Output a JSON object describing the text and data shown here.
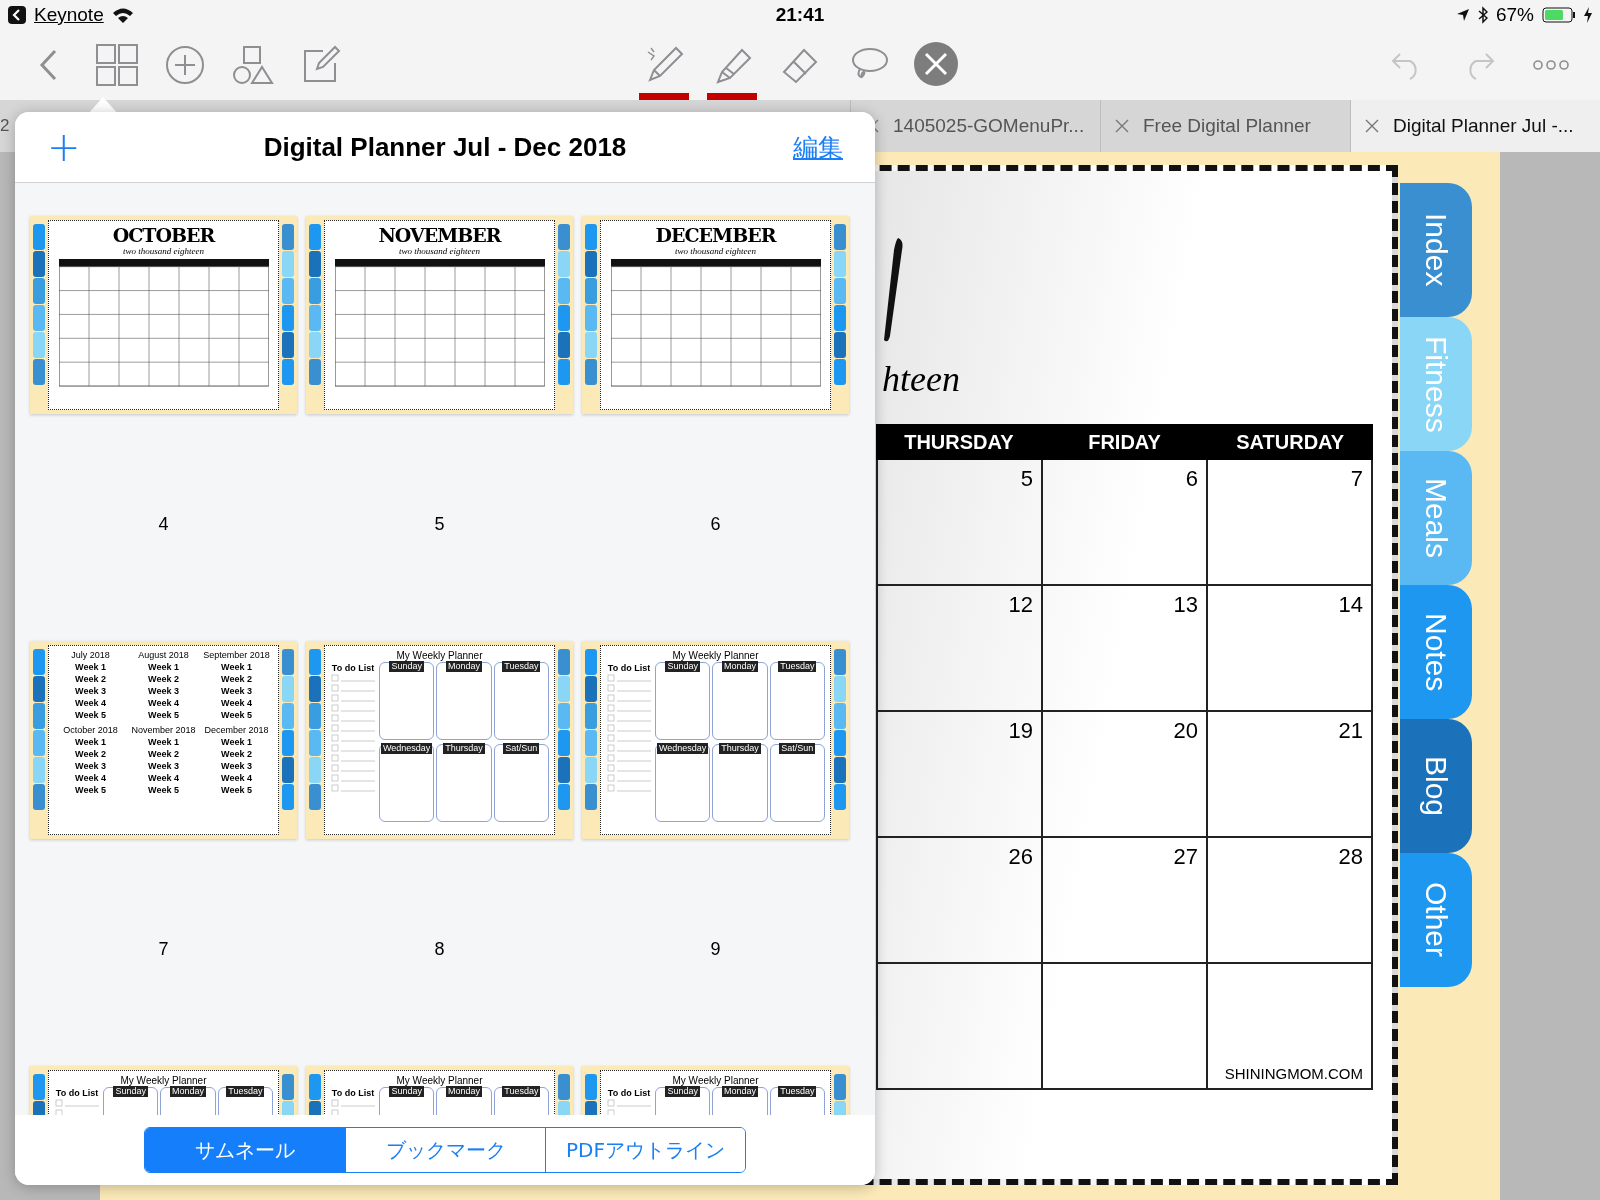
{
  "status_bar": {
    "back_app": "Keynote",
    "time": "21:41",
    "battery": "67%"
  },
  "drawing_tools": [
    {
      "kind": "pen",
      "color": "#c40000"
    },
    {
      "kind": "highlighter",
      "color": "#c40000"
    },
    {
      "kind": "eraser"
    },
    {
      "kind": "lasso"
    },
    {
      "kind": "close"
    }
  ],
  "tabs": [
    {
      "label": "2",
      "selected": false
    },
    {
      "label": "1405025-GOMenuPr...",
      "selected": false
    },
    {
      "label": "Free Digital Planner",
      "selected": false
    },
    {
      "label": "Digital Planner Jul -...",
      "selected": true
    }
  ],
  "popover": {
    "add": "+",
    "title": "Digital Planner Jul - Dec 2018",
    "edit": "編集",
    "thumbnails": [
      {
        "kind": "month",
        "title": "OCTOBER",
        "subtitle": "two thousand eighteen",
        "page": "4"
      },
      {
        "kind": "month",
        "title": "NOVEMBER",
        "subtitle": "two thousand eighteen",
        "page": "5"
      },
      {
        "kind": "month",
        "title": "DECEMBER",
        "subtitle": "two thousand eighteen",
        "page": "6"
      },
      {
        "kind": "index",
        "page": "7",
        "months": [
          {
            "title": "July 2018",
            "weeks": [
              "Week 1",
              "Week 2",
              "Week 3",
              "Week 4",
              "Week 5"
            ]
          },
          {
            "title": "August 2018",
            "weeks": [
              "Week 1",
              "Week 2",
              "Week 3",
              "Week 4",
              "Week 5"
            ]
          },
          {
            "title": "September 2018",
            "weeks": [
              "Week 1",
              "Week 2",
              "Week 3",
              "Week 4",
              "Week 5"
            ]
          },
          {
            "title": "October 2018",
            "weeks": [
              "Week 1",
              "Week 2",
              "Week 3",
              "Week 4",
              "Week 5"
            ]
          },
          {
            "title": "November 2018",
            "weeks": [
              "Week 1",
              "Week 2",
              "Week 3",
              "Week 4",
              "Week 5"
            ]
          },
          {
            "title": "December 2018",
            "weeks": [
              "Week 1",
              "Week 2",
              "Week 3",
              "Week 4",
              "Week 5"
            ]
          }
        ]
      },
      {
        "kind": "weekly",
        "page": "8",
        "title": "My Weekly Planner",
        "todo": "To do List",
        "days": [
          "Sunday",
          "Monday",
          "Tuesday",
          "Wednesday",
          "Thursday",
          "Sat/Sun"
        ]
      },
      {
        "kind": "weekly",
        "page": "9",
        "title": "My Weekly Planner",
        "todo": "To do List",
        "days": [
          "Sunday",
          "Monday",
          "Tuesday",
          "Wednesday",
          "Thursday",
          "Sat/Sun"
        ]
      },
      {
        "kind": "weekly",
        "title": "My Weekly Planner",
        "todo": "To do List",
        "days": [
          "Sunday",
          "Monday",
          "Tuesday"
        ]
      },
      {
        "kind": "weekly",
        "title": "My Weekly Planner",
        "todo": "To do List",
        "days": [
          "Sunday",
          "Monday",
          "Tuesday"
        ]
      },
      {
        "kind": "weekly",
        "title": "My Weekly Planner",
        "todo": "To do List",
        "days": [
          "Sunday",
          "Monday",
          "Tuesday"
        ]
      }
    ],
    "segments": [
      {
        "label": "サムネール",
        "selected": true
      },
      {
        "label": "ブックマーク",
        "selected": false
      },
      {
        "label": "PDFアウトライン",
        "selected": false
      }
    ]
  },
  "page": {
    "lettering": "hteen",
    "columns": [
      "THURSDAY",
      "FRIDAY",
      "SATURDAY"
    ],
    "weeks": [
      [
        "5",
        "6",
        "7"
      ],
      [
        "12",
        "13",
        "14"
      ],
      [
        "19",
        "20",
        "21"
      ],
      [
        "26",
        "27",
        "28"
      ]
    ],
    "footer": "SHININGMOM.COM",
    "section_tabs": [
      {
        "label": "Index",
        "color": "#3a8fd0"
      },
      {
        "label": "Fitness",
        "color": "#8ad6f7"
      },
      {
        "label": "Meals",
        "color": "#5ab9f2"
      },
      {
        "label": "Notes",
        "color": "#1e97f0"
      },
      {
        "label": "Blog",
        "color": "#1b72ba"
      },
      {
        "label": "Other",
        "color": "#1e97f0"
      }
    ]
  }
}
